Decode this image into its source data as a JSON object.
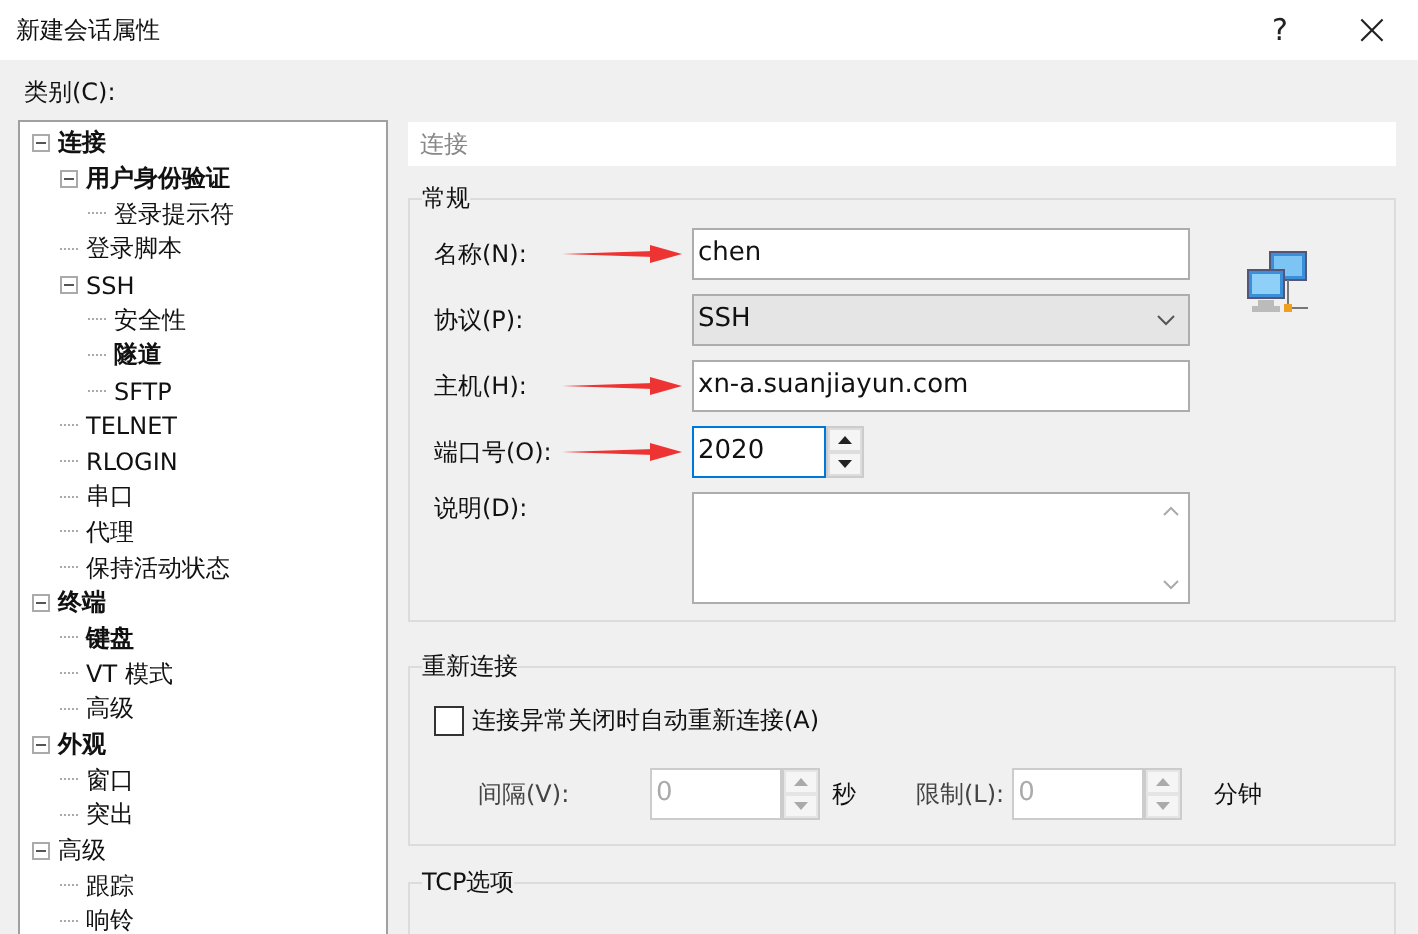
{
  "window": {
    "title": "新建会话属性",
    "help": "?",
    "close": "×"
  },
  "category_label": "类别(C):",
  "tree": [
    {
      "label": "连接",
      "bold": true,
      "expanded": true,
      "selected": false,
      "children": [
        {
          "label": "用户身份验证",
          "bold": true,
          "expanded": true,
          "selected": false,
          "children": [
            {
              "label": "登录提示符",
              "bold": false,
              "selected": false
            }
          ]
        },
        {
          "label": "登录脚本",
          "bold": false,
          "selected": false
        },
        {
          "label": "SSH",
          "bold": false,
          "expanded": true,
          "selected": false,
          "children": [
            {
              "label": "安全性",
              "bold": false,
              "selected": false
            },
            {
              "label": "隧道",
              "bold": true,
              "selected": false
            },
            {
              "label": "SFTP",
              "bold": false,
              "selected": false
            }
          ]
        },
        {
          "label": "TELNET",
          "bold": false,
          "selected": false
        },
        {
          "label": "RLOGIN",
          "bold": false,
          "selected": false
        },
        {
          "label": "串口",
          "bold": false,
          "selected": false
        },
        {
          "label": "代理",
          "bold": false,
          "selected": false
        },
        {
          "label": "保持活动状态",
          "bold": false,
          "selected": false
        }
      ]
    },
    {
      "label": "终端",
      "bold": true,
      "expanded": true,
      "selected": false,
      "children": [
        {
          "label": "键盘",
          "bold": true,
          "selected": false
        },
        {
          "label": "VT 模式",
          "bold": false,
          "selected": false
        },
        {
          "label": "高级",
          "bold": false,
          "selected": false
        }
      ]
    },
    {
      "label": "外观",
      "bold": true,
      "expanded": true,
      "selected": false,
      "children": [
        {
          "label": "窗口",
          "bold": false,
          "selected": false
        },
        {
          "label": "突出",
          "bold": false,
          "selected": false
        }
      ]
    },
    {
      "label": "高级",
      "bold": false,
      "expanded": true,
      "selected": false,
      "children": [
        {
          "label": "跟踪",
          "bold": false,
          "selected": false
        },
        {
          "label": "响铃",
          "bold": false,
          "selected": false
        }
      ]
    }
  ],
  "section_header": "连接",
  "general": {
    "title": "常规",
    "fields": [
      {
        "kind": "text",
        "label": "名称(N):",
        "value": "chen",
        "arrow": true
      },
      {
        "kind": "select",
        "label": "协议(P):",
        "value": "SSH",
        "arrow": false
      },
      {
        "kind": "text",
        "label": "主机(H):",
        "value": "xn-a.suanjiayun.com",
        "arrow": true
      },
      {
        "kind": "spinner",
        "label": "端口号(O):",
        "value": "2020",
        "arrow": true
      },
      {
        "kind": "textarea",
        "label": "说明(D):",
        "arrow": false
      }
    ]
  },
  "reconnect": {
    "title": "重新连接",
    "checkbox": {
      "label": "连接异常关闭时自动重新连接(A)",
      "checked": false
    },
    "interval": {
      "label": "间隔(V):",
      "value": "0",
      "unit": "秒",
      "disabled": true
    },
    "limit": {
      "label": "限制(L):",
      "value": "0",
      "unit": "分钟",
      "disabled": true
    }
  },
  "tcp": {
    "title": "TCP选项"
  }
}
